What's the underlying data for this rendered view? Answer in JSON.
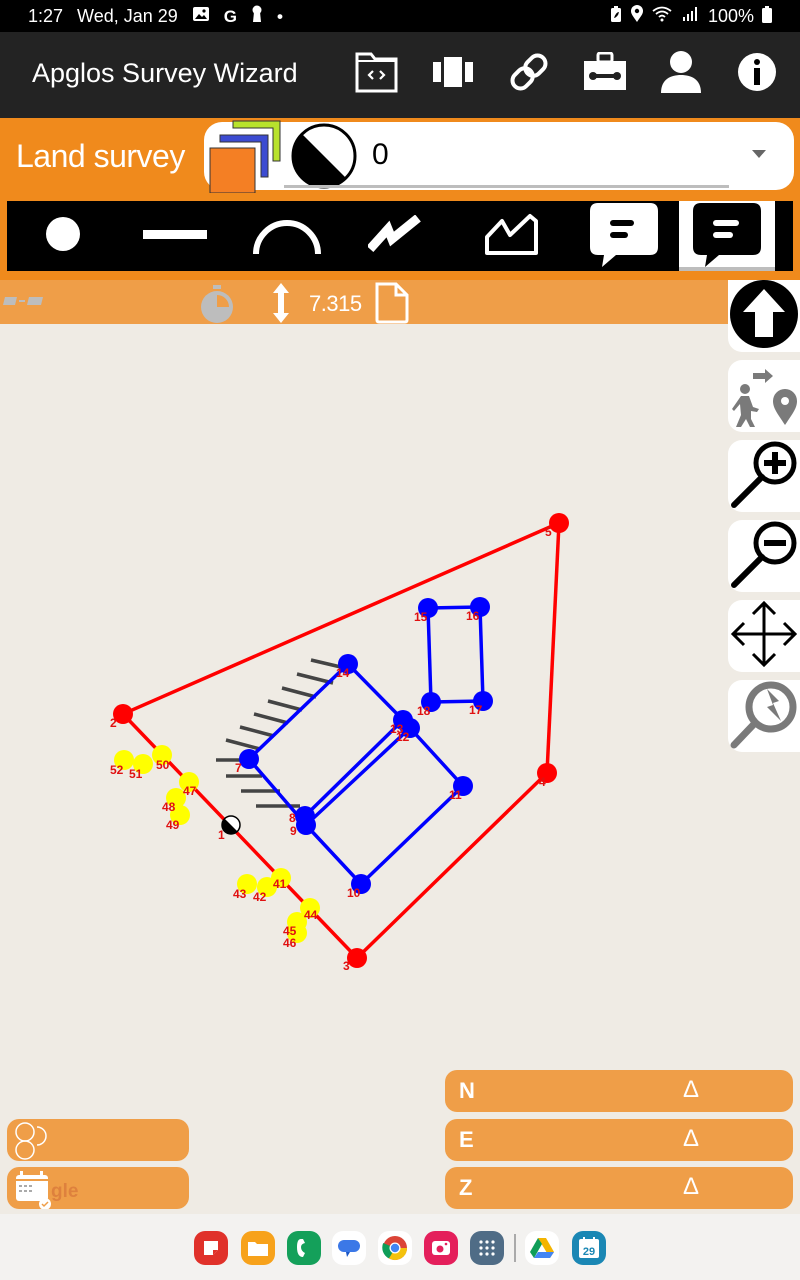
{
  "status_bar": {
    "time": "1:27",
    "date": "Wed, Jan 29",
    "left_icons": [
      "gallery-icon",
      "google-icon",
      "keyhole-icon",
      "dot-icon"
    ],
    "right_icons": [
      "battery-saver-icon",
      "location-icon",
      "wifi-icon",
      "signal-icon"
    ],
    "battery": "100%"
  },
  "app_bar": {
    "title": "Apglos Survey Wizard",
    "actions": [
      {
        "name": "folder-code-icon",
        "label": "Project files"
      },
      {
        "name": "columns-icon",
        "label": "Views"
      },
      {
        "name": "link-icon",
        "label": "Connect"
      },
      {
        "name": "toolbox-icon",
        "label": "Tools"
      },
      {
        "name": "user-icon",
        "label": "Account"
      },
      {
        "name": "info-icon",
        "label": "About"
      }
    ]
  },
  "header": {
    "section_title": "Land survey",
    "layer_select": {
      "value": "0",
      "layer_colors": {
        "front": "#f47f24",
        "middle": "#3c4bd1",
        "back": "#b8e22c"
      }
    }
  },
  "tools": [
    {
      "name": "point-tool",
      "icon": "dot-icon",
      "selected": false
    },
    {
      "name": "line-tool",
      "icon": "line-icon",
      "selected": false
    },
    {
      "name": "arc-tool",
      "icon": "arc-icon",
      "selected": false
    },
    {
      "name": "polyline-tool",
      "icon": "zigzag-icon",
      "selected": false
    },
    {
      "name": "polygon-tool",
      "icon": "polygon-icon",
      "selected": false
    },
    {
      "name": "note-tool",
      "icon": "comment-icon",
      "selected": false
    },
    {
      "name": "note-tool-alt",
      "icon": "comment-icon",
      "selected": true
    }
  ],
  "info_strip": {
    "gps_icon": "satellite-icon",
    "timer_icon": "stopwatch-icon",
    "height_icon": "vertical-arrows-icon",
    "height_value": "7.315",
    "file_icon": "file-icon"
  },
  "side_tools": [
    {
      "name": "north-up-button",
      "icon": "up-arrow-icon"
    },
    {
      "name": "stakeout-button",
      "icon": "walk-to-location-icon"
    },
    {
      "name": "zoom-in-button",
      "icon": "zoom-in-icon"
    },
    {
      "name": "zoom-out-button",
      "icon": "zoom-out-icon"
    },
    {
      "name": "pan-button",
      "icon": "move-arrows-icon"
    },
    {
      "name": "snap-search-button",
      "icon": "search-flash-icon"
    }
  ],
  "map": {
    "boundary_color": "#ff0000",
    "building_color": "#0000ff",
    "control_color": "#ffff00",
    "label_color": "#e01010",
    "boundary_points": [
      {
        "id": "2"
      },
      {
        "id": "5"
      },
      {
        "id": "4"
      },
      {
        "id": "3"
      }
    ],
    "building_points": [
      {
        "id": "14"
      },
      {
        "id": "13"
      },
      {
        "id": "12"
      },
      {
        "id": "11"
      },
      {
        "id": "10"
      },
      {
        "id": "9"
      },
      {
        "id": "8"
      },
      {
        "id": "7"
      },
      {
        "id": "15"
      },
      {
        "id": "16"
      },
      {
        "id": "17"
      },
      {
        "id": "18"
      }
    ],
    "control_points": [
      {
        "id": "52"
      },
      {
        "id": "51"
      },
      {
        "id": "50"
      },
      {
        "id": "47"
      },
      {
        "id": "48"
      },
      {
        "id": "49"
      },
      {
        "id": "43"
      },
      {
        "id": "42"
      },
      {
        "id": "41"
      },
      {
        "id": "44"
      },
      {
        "id": "45"
      },
      {
        "id": "46"
      }
    ],
    "current_position_label": "1"
  },
  "coords": [
    {
      "axis": "N",
      "delta": "Δ"
    },
    {
      "axis": "E",
      "delta": "Δ"
    },
    {
      "axis": "Z",
      "delta": "Δ"
    }
  ],
  "left_buttons": [
    {
      "name": "layers-circles-button",
      "icon": "circles-icon"
    },
    {
      "name": "google-calendar-button",
      "icon": "calendar-icon",
      "text": "gle"
    }
  ],
  "dock": {
    "apps": [
      {
        "name": "notes-app",
        "color": "#e0312a"
      },
      {
        "name": "files-app",
        "color": "#f7a21b"
      },
      {
        "name": "phone-app",
        "color": "#14a05a"
      },
      {
        "name": "messages-app",
        "color": "#ffffff"
      },
      {
        "name": "chrome-app",
        "color": "#ffffff"
      },
      {
        "name": "camera-app",
        "color": "#e41f5b"
      },
      {
        "name": "app-drawer",
        "color": "#4f6c86"
      },
      {
        "name": "drive-app",
        "color": "#ffffff"
      },
      {
        "name": "calendar-app",
        "color": "#1a87b4",
        "badge": "29"
      }
    ]
  }
}
